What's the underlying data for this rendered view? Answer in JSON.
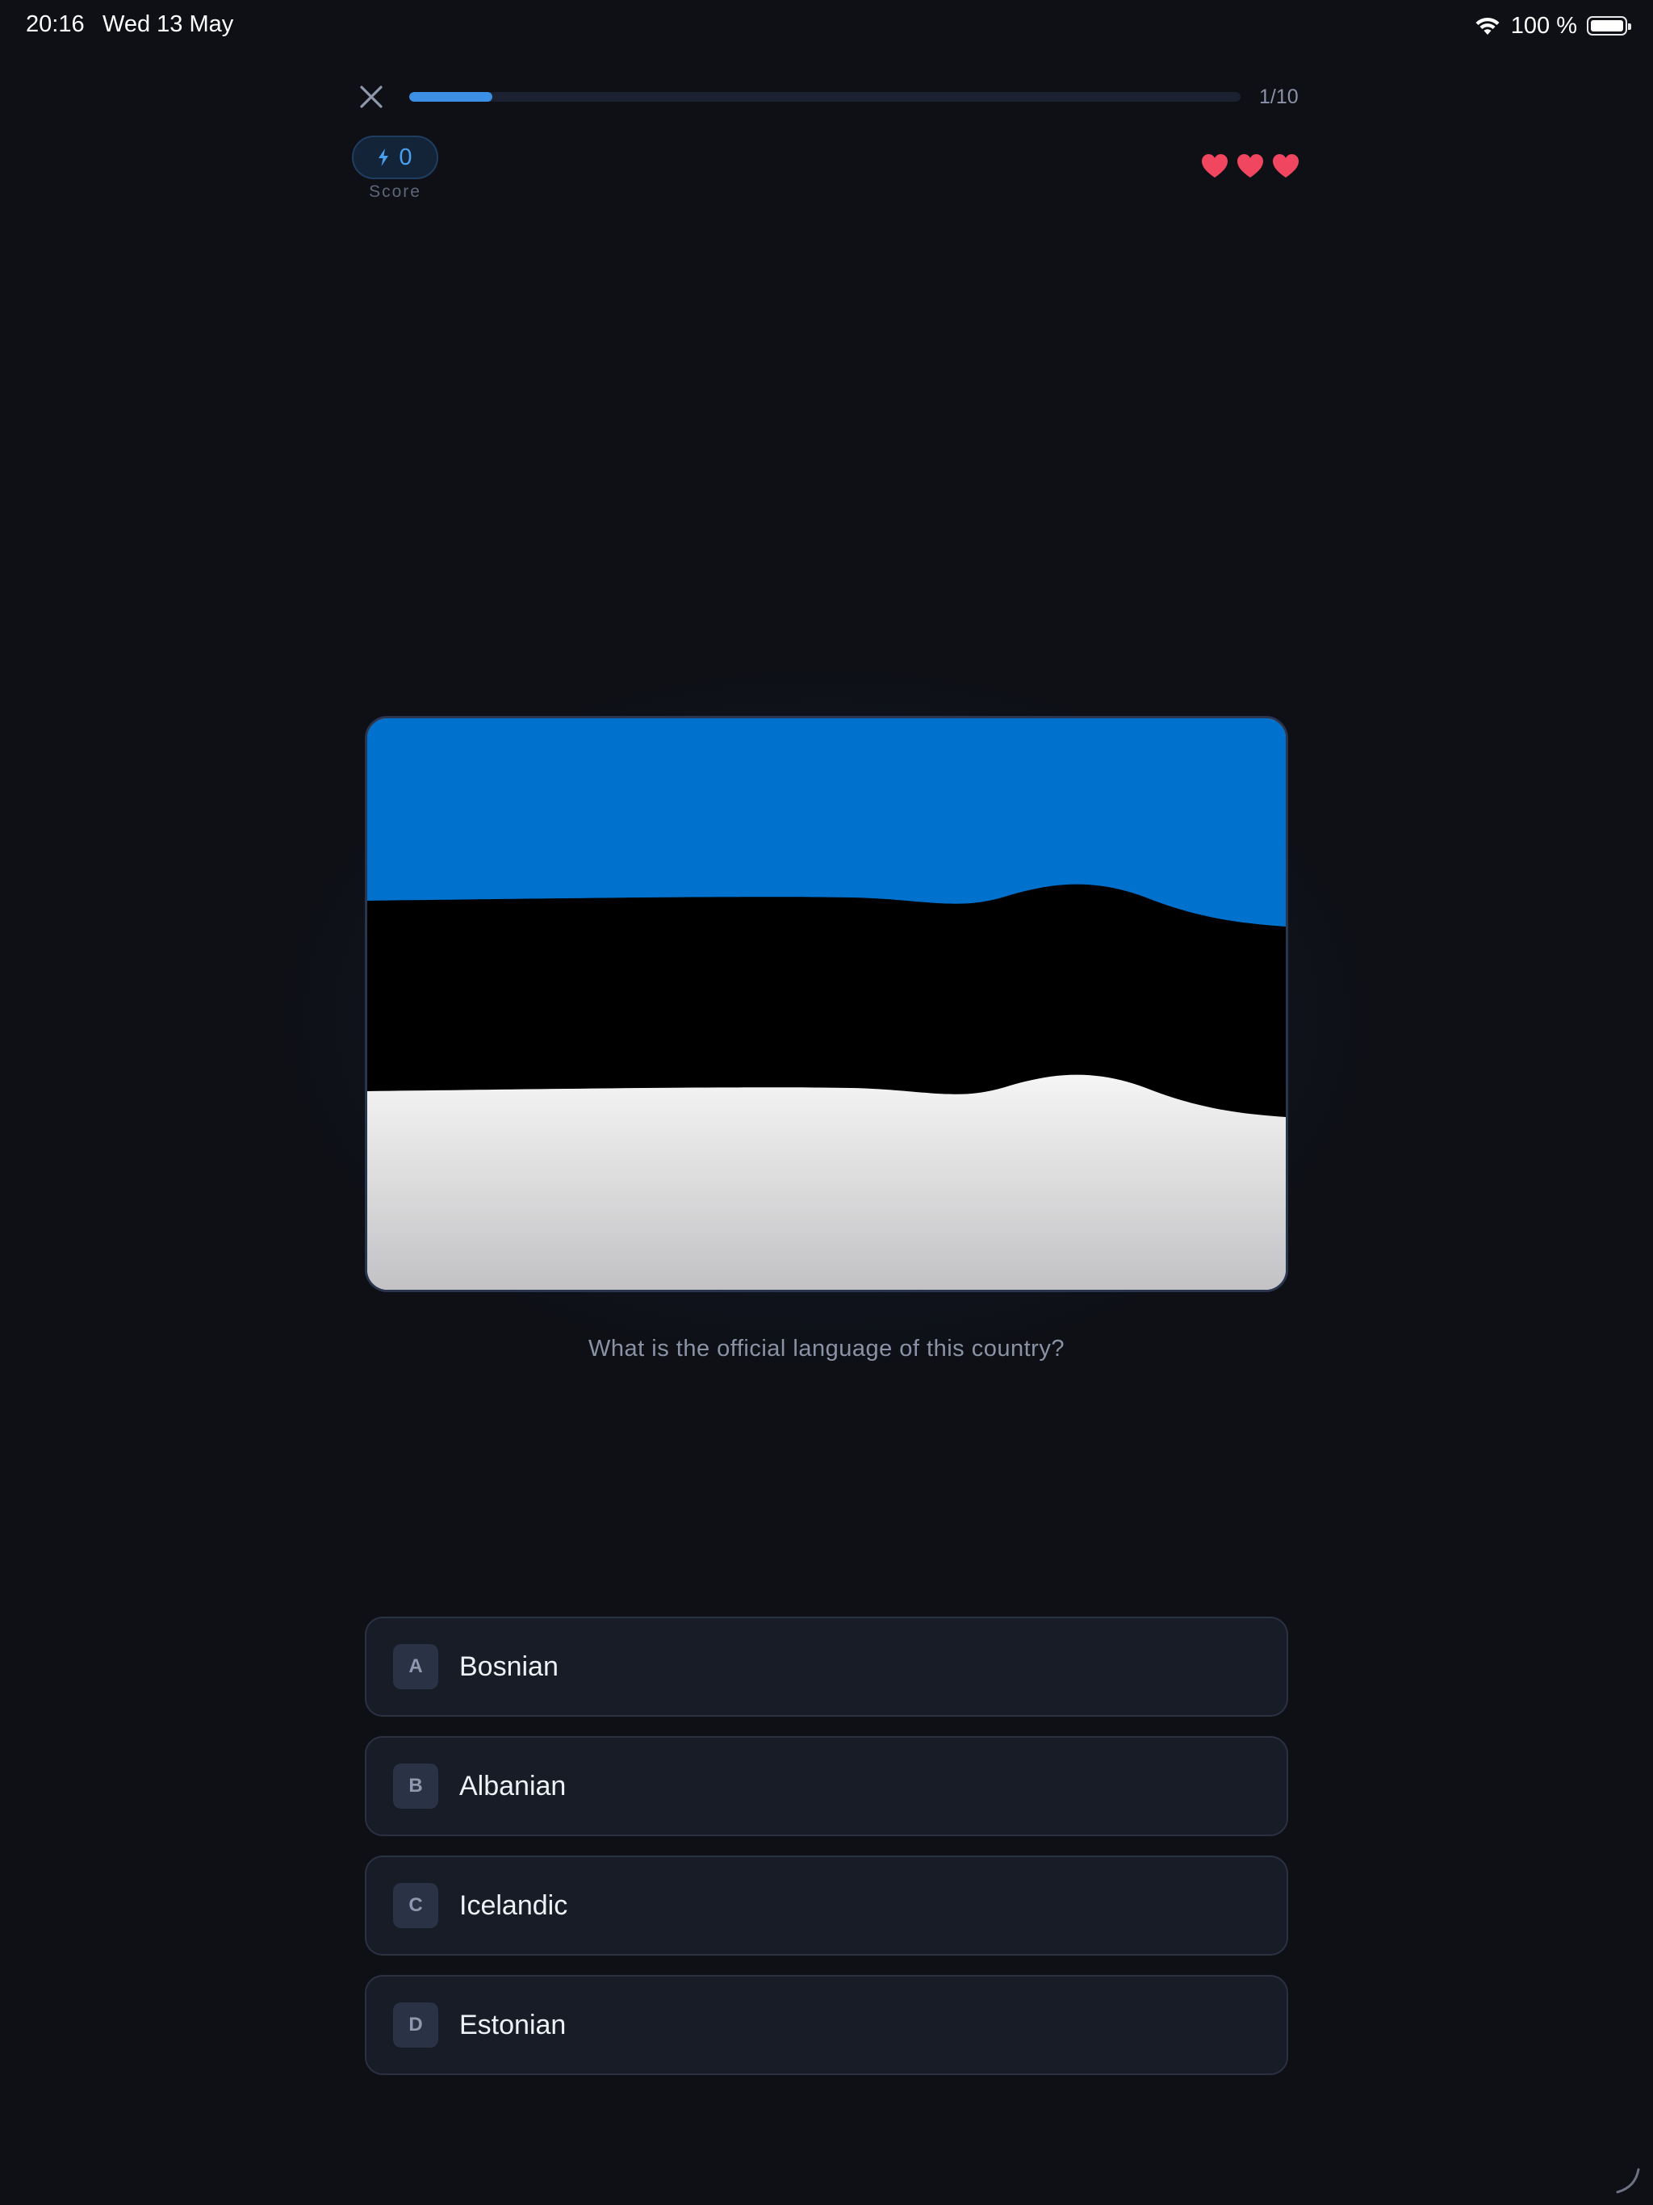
{
  "status_bar": {
    "time": "20:16",
    "date": "Wed 13 May",
    "battery_text": "100 %",
    "icons": [
      "wifi-icon",
      "battery-icon"
    ]
  },
  "top_bar": {
    "close_icon": "close-icon",
    "progress_fraction": 0.1,
    "progress_label": "1/10",
    "accent_color": "#3d8fe6"
  },
  "score": {
    "icon": "lightning-icon",
    "value": "0",
    "label": "Score"
  },
  "lives": {
    "count": 3,
    "icon": "heart-icon",
    "color": "#f0465f"
  },
  "flag": {
    "country_colors": [
      "#0072ce",
      "#000000",
      "#ffffff"
    ]
  },
  "question": "What is the official language of this country?",
  "options": [
    {
      "letter": "A",
      "text": "Bosnian"
    },
    {
      "letter": "B",
      "text": "Albanian"
    },
    {
      "letter": "C",
      "text": "Icelandic"
    },
    {
      "letter": "D",
      "text": "Estonian"
    }
  ]
}
